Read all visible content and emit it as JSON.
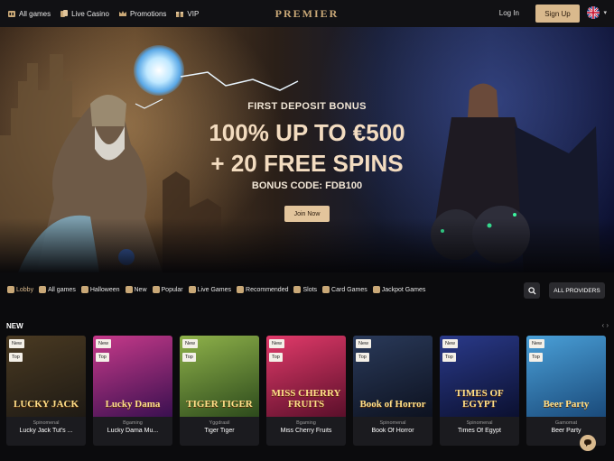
{
  "header": {
    "logo": "PREMIER",
    "nav": [
      {
        "label": "All games",
        "icon": "slots-icon"
      },
      {
        "label": "Live Casino",
        "icon": "cards-icon"
      },
      {
        "label": "Promotions",
        "icon": "crown-icon"
      },
      {
        "label": "VIP",
        "icon": "gift-icon"
      }
    ],
    "login_label": "Log In",
    "signup_label": "Sign Up",
    "language_icon": "uk-flag-icon"
  },
  "hero": {
    "eyebrow": "FIRST DEPOSIT BONUS",
    "line1": "100% UP TO €500",
    "line2": "+ 20 FREE SPINS",
    "code": "BONUS CODE: FDB100",
    "cta": "Join Now"
  },
  "categories": [
    {
      "label": "Lobby",
      "active": true
    },
    {
      "label": "All games"
    },
    {
      "label": "Halloween"
    },
    {
      "label": "New"
    },
    {
      "label": "Popular"
    },
    {
      "label": "Live Games"
    },
    {
      "label": "Recommended"
    },
    {
      "label": "Slots"
    },
    {
      "label": "Card Games"
    },
    {
      "label": "Jackpot Games"
    }
  ],
  "providers_label": "ALL PROVIDERS",
  "section": {
    "title": "NEW",
    "arrows": "‹ ›"
  },
  "badges": {
    "new": "New",
    "top": "Top"
  },
  "games": [
    {
      "provider": "Spinomenal",
      "name": "Lucky Jack Tut's ...",
      "art_text": "LUCKY JACK",
      "color1": "#4a3a22",
      "color2": "#1e1a14"
    },
    {
      "provider": "Bgaming",
      "name": "Lucky Dama Mu...",
      "art_text": "Lucky Dama",
      "color1": "#c73a8a",
      "color2": "#3a1050"
    },
    {
      "provider": "Yggdrasil",
      "name": "Tiger Tiger",
      "art_text": "TIGER TIGER",
      "color1": "#8fb24a",
      "color2": "#2d4a1c"
    },
    {
      "provider": "Bgaming",
      "name": "Miss Cherry Fruits",
      "art_text": "MISS CHERRY FRUITS",
      "color1": "#e23a6a",
      "color2": "#5a0f2a"
    },
    {
      "provider": "Spinomenal",
      "name": "Book Of Horror",
      "art_text": "Book of Horror",
      "color1": "#2a3a5a",
      "color2": "#0d1220"
    },
    {
      "provider": "Spinomenal",
      "name": "Times Of Egypt",
      "art_text": "TIMES OF EGYPT",
      "color1": "#2a3a8a",
      "color2": "#0b1030"
    },
    {
      "provider": "Gamomat",
      "name": "Beer Party",
      "art_text": "Beer Party",
      "color1": "#4aa0d8",
      "color2": "#1a4a7a"
    }
  ]
}
